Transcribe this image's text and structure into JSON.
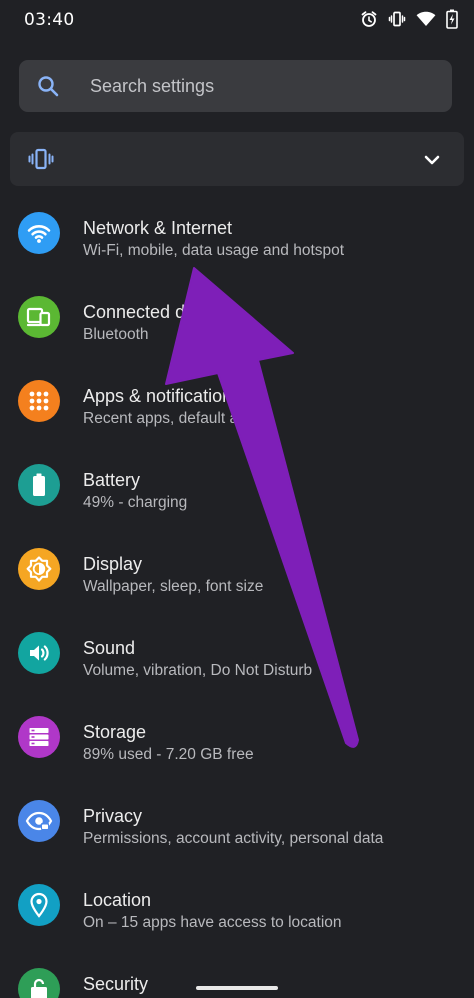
{
  "status_bar": {
    "time": "03:40",
    "icons": [
      "alarm-icon",
      "vibrate-icon",
      "wifi-icon",
      "battery-charging-icon"
    ]
  },
  "search": {
    "placeholder": "Search settings"
  },
  "mode_card": {
    "icon": "vibrate-icon",
    "expand_icon": "chevron-down-icon"
  },
  "settings": [
    {
      "title": "Network & Internet",
      "subtitle": "Wi-Fi, mobile, data usage and hotspot",
      "icon": "wifi-icon",
      "color": "#2f9df4"
    },
    {
      "title": "Connected devices",
      "subtitle": "Bluetooth",
      "icon": "devices-icon",
      "color": "#5bb833"
    },
    {
      "title": "Apps & notifications",
      "subtitle": "Recent apps, default apps",
      "icon": "apps-grid-icon",
      "color": "#f4801e"
    },
    {
      "title": "Battery",
      "subtitle": "49% - charging",
      "icon": "battery-icon",
      "color": "#1d9e93"
    },
    {
      "title": "Display",
      "subtitle": "Wallpaper, sleep, font size",
      "icon": "brightness-icon",
      "color": "#f5a623"
    },
    {
      "title": "Sound",
      "subtitle": "Volume, vibration, Do Not Disturb",
      "icon": "volume-icon",
      "color": "#12a5a0"
    },
    {
      "title": "Storage",
      "subtitle": "89% used - 7.20 GB free",
      "icon": "storage-icon",
      "color": "#b037c8"
    },
    {
      "title": "Privacy",
      "subtitle": "Permissions, account activity, personal data",
      "icon": "eye-icon",
      "color": "#4a86e8"
    },
    {
      "title": "Location",
      "subtitle": "On – 15 apps have access to location",
      "icon": "location-pin-icon",
      "color": "#12a0c4"
    },
    {
      "title": "Security",
      "subtitle": "",
      "icon": "lock-icon",
      "color": "#2e9e57"
    }
  ],
  "overlay": {
    "arrow_color": "#7e1fb8",
    "arrow_target": "Network & Internet"
  }
}
